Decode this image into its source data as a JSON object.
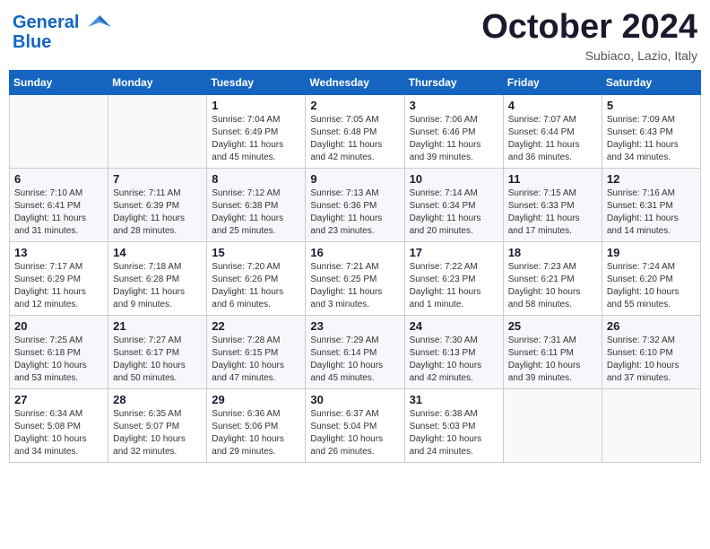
{
  "header": {
    "logo_line1": "General",
    "logo_line2": "Blue",
    "month": "October 2024",
    "location": "Subiaco, Lazio, Italy"
  },
  "weekdays": [
    "Sunday",
    "Monday",
    "Tuesday",
    "Wednesday",
    "Thursday",
    "Friday",
    "Saturday"
  ],
  "weeks": [
    [
      {
        "day": "",
        "sunrise": "",
        "sunset": "",
        "daylight": ""
      },
      {
        "day": "",
        "sunrise": "",
        "sunset": "",
        "daylight": ""
      },
      {
        "day": "1",
        "sunrise": "Sunrise: 7:04 AM",
        "sunset": "Sunset: 6:49 PM",
        "daylight": "Daylight: 11 hours and 45 minutes."
      },
      {
        "day": "2",
        "sunrise": "Sunrise: 7:05 AM",
        "sunset": "Sunset: 6:48 PM",
        "daylight": "Daylight: 11 hours and 42 minutes."
      },
      {
        "day": "3",
        "sunrise": "Sunrise: 7:06 AM",
        "sunset": "Sunset: 6:46 PM",
        "daylight": "Daylight: 11 hours and 39 minutes."
      },
      {
        "day": "4",
        "sunrise": "Sunrise: 7:07 AM",
        "sunset": "Sunset: 6:44 PM",
        "daylight": "Daylight: 11 hours and 36 minutes."
      },
      {
        "day": "5",
        "sunrise": "Sunrise: 7:09 AM",
        "sunset": "Sunset: 6:43 PM",
        "daylight": "Daylight: 11 hours and 34 minutes."
      }
    ],
    [
      {
        "day": "6",
        "sunrise": "Sunrise: 7:10 AM",
        "sunset": "Sunset: 6:41 PM",
        "daylight": "Daylight: 11 hours and 31 minutes."
      },
      {
        "day": "7",
        "sunrise": "Sunrise: 7:11 AM",
        "sunset": "Sunset: 6:39 PM",
        "daylight": "Daylight: 11 hours and 28 minutes."
      },
      {
        "day": "8",
        "sunrise": "Sunrise: 7:12 AM",
        "sunset": "Sunset: 6:38 PM",
        "daylight": "Daylight: 11 hours and 25 minutes."
      },
      {
        "day": "9",
        "sunrise": "Sunrise: 7:13 AM",
        "sunset": "Sunset: 6:36 PM",
        "daylight": "Daylight: 11 hours and 23 minutes."
      },
      {
        "day": "10",
        "sunrise": "Sunrise: 7:14 AM",
        "sunset": "Sunset: 6:34 PM",
        "daylight": "Daylight: 11 hours and 20 minutes."
      },
      {
        "day": "11",
        "sunrise": "Sunrise: 7:15 AM",
        "sunset": "Sunset: 6:33 PM",
        "daylight": "Daylight: 11 hours and 17 minutes."
      },
      {
        "day": "12",
        "sunrise": "Sunrise: 7:16 AM",
        "sunset": "Sunset: 6:31 PM",
        "daylight": "Daylight: 11 hours and 14 minutes."
      }
    ],
    [
      {
        "day": "13",
        "sunrise": "Sunrise: 7:17 AM",
        "sunset": "Sunset: 6:29 PM",
        "daylight": "Daylight: 11 hours and 12 minutes."
      },
      {
        "day": "14",
        "sunrise": "Sunrise: 7:18 AM",
        "sunset": "Sunset: 6:28 PM",
        "daylight": "Daylight: 11 hours and 9 minutes."
      },
      {
        "day": "15",
        "sunrise": "Sunrise: 7:20 AM",
        "sunset": "Sunset: 6:26 PM",
        "daylight": "Daylight: 11 hours and 6 minutes."
      },
      {
        "day": "16",
        "sunrise": "Sunrise: 7:21 AM",
        "sunset": "Sunset: 6:25 PM",
        "daylight": "Daylight: 11 hours and 3 minutes."
      },
      {
        "day": "17",
        "sunrise": "Sunrise: 7:22 AM",
        "sunset": "Sunset: 6:23 PM",
        "daylight": "Daylight: 11 hours and 1 minute."
      },
      {
        "day": "18",
        "sunrise": "Sunrise: 7:23 AM",
        "sunset": "Sunset: 6:21 PM",
        "daylight": "Daylight: 10 hours and 58 minutes."
      },
      {
        "day": "19",
        "sunrise": "Sunrise: 7:24 AM",
        "sunset": "Sunset: 6:20 PM",
        "daylight": "Daylight: 10 hours and 55 minutes."
      }
    ],
    [
      {
        "day": "20",
        "sunrise": "Sunrise: 7:25 AM",
        "sunset": "Sunset: 6:18 PM",
        "daylight": "Daylight: 10 hours and 53 minutes."
      },
      {
        "day": "21",
        "sunrise": "Sunrise: 7:27 AM",
        "sunset": "Sunset: 6:17 PM",
        "daylight": "Daylight: 10 hours and 50 minutes."
      },
      {
        "day": "22",
        "sunrise": "Sunrise: 7:28 AM",
        "sunset": "Sunset: 6:15 PM",
        "daylight": "Daylight: 10 hours and 47 minutes."
      },
      {
        "day": "23",
        "sunrise": "Sunrise: 7:29 AM",
        "sunset": "Sunset: 6:14 PM",
        "daylight": "Daylight: 10 hours and 45 minutes."
      },
      {
        "day": "24",
        "sunrise": "Sunrise: 7:30 AM",
        "sunset": "Sunset: 6:13 PM",
        "daylight": "Daylight: 10 hours and 42 minutes."
      },
      {
        "day": "25",
        "sunrise": "Sunrise: 7:31 AM",
        "sunset": "Sunset: 6:11 PM",
        "daylight": "Daylight: 10 hours and 39 minutes."
      },
      {
        "day": "26",
        "sunrise": "Sunrise: 7:32 AM",
        "sunset": "Sunset: 6:10 PM",
        "daylight": "Daylight: 10 hours and 37 minutes."
      }
    ],
    [
      {
        "day": "27",
        "sunrise": "Sunrise: 6:34 AM",
        "sunset": "Sunset: 5:08 PM",
        "daylight": "Daylight: 10 hours and 34 minutes."
      },
      {
        "day": "28",
        "sunrise": "Sunrise: 6:35 AM",
        "sunset": "Sunset: 5:07 PM",
        "daylight": "Daylight: 10 hours and 32 minutes."
      },
      {
        "day": "29",
        "sunrise": "Sunrise: 6:36 AM",
        "sunset": "Sunset: 5:06 PM",
        "daylight": "Daylight: 10 hours and 29 minutes."
      },
      {
        "day": "30",
        "sunrise": "Sunrise: 6:37 AM",
        "sunset": "Sunset: 5:04 PM",
        "daylight": "Daylight: 10 hours and 26 minutes."
      },
      {
        "day": "31",
        "sunrise": "Sunrise: 6:38 AM",
        "sunset": "Sunset: 5:03 PM",
        "daylight": "Daylight: 10 hours and 24 minutes."
      },
      {
        "day": "",
        "sunrise": "",
        "sunset": "",
        "daylight": ""
      },
      {
        "day": "",
        "sunrise": "",
        "sunset": "",
        "daylight": ""
      }
    ]
  ]
}
